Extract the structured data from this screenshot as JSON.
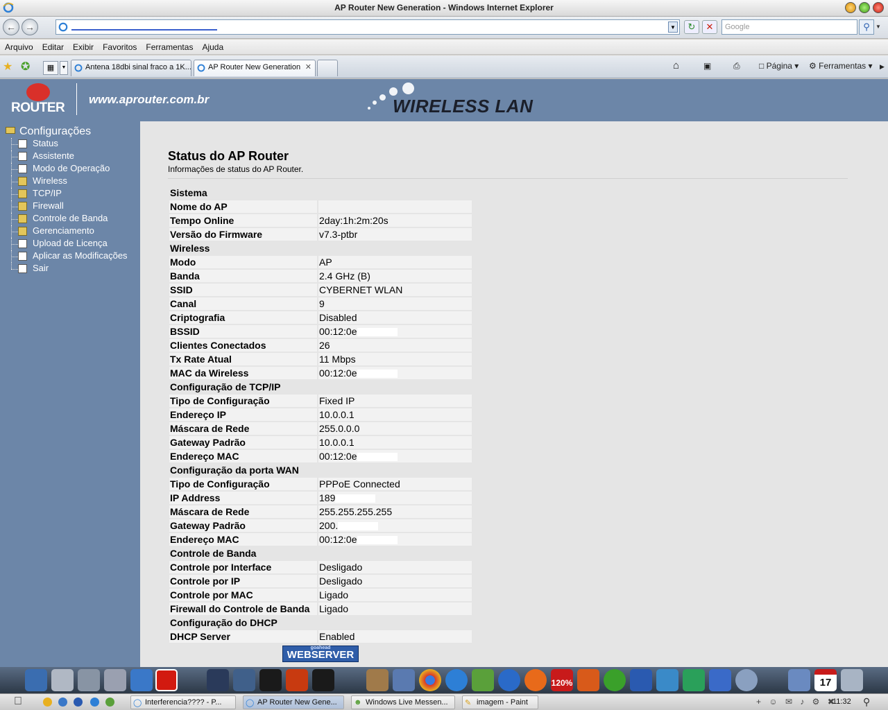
{
  "window": {
    "title": "AP Router New Generation - Windows Internet Explorer"
  },
  "search": {
    "placeholder": "Google"
  },
  "menu": [
    "Arquivo",
    "Editar",
    "Exibir",
    "Favoritos",
    "Ferramentas",
    "Ajuda"
  ],
  "tabs": [
    {
      "label": "Antena 18dbi sinal fraco a 1K..."
    },
    {
      "label": "AP Router New Generation"
    }
  ],
  "toolbar": {
    "page_label": "Página",
    "tools_label": "Ferramentas"
  },
  "banner": {
    "logo": "ROUTER",
    "site": "www.aprouter.com.br",
    "wireless": "WIRELESS LAN"
  },
  "sidebar": {
    "root": "Configurações",
    "items": [
      {
        "label": "Status",
        "icon": "doc"
      },
      {
        "label": "Assistente",
        "icon": "doc"
      },
      {
        "label": "Modo de Operação",
        "icon": "doc"
      },
      {
        "label": "Wireless",
        "icon": "folder"
      },
      {
        "label": "TCP/IP",
        "icon": "folder"
      },
      {
        "label": "Firewall",
        "icon": "folder"
      },
      {
        "label": "Controle de Banda",
        "icon": "folder"
      },
      {
        "label": "Gerenciamento",
        "icon": "folder"
      },
      {
        "label": "Upload de Licença",
        "icon": "doc"
      },
      {
        "label": "Aplicar as Modificações",
        "icon": "doc"
      },
      {
        "label": "Sair",
        "icon": "doc"
      }
    ]
  },
  "content": {
    "title": "Status do AP Router",
    "subtitle": "Informações de status do AP Router.",
    "sections": [
      {
        "name": "Sistema",
        "rows": [
          {
            "label": "Nome do AP",
            "value": ""
          },
          {
            "label": "Tempo Online",
            "value": "2day:1h:2m:20s"
          },
          {
            "label": "Versão do Firmware",
            "value": "v7.3-ptbr"
          }
        ]
      },
      {
        "name": "Wireless",
        "rows": [
          {
            "label": "Modo",
            "value": "AP"
          },
          {
            "label": "Banda",
            "value": "2.4 GHz (B)"
          },
          {
            "label": "SSID",
            "value": "CYBERNET WLAN"
          },
          {
            "label": "Canal",
            "value": "9"
          },
          {
            "label": "Criptografia",
            "value": "Disabled"
          },
          {
            "label": "BSSID",
            "value": "00:12:0e",
            "masked": true
          },
          {
            "label": "Clientes Conectados",
            "value": "26"
          },
          {
            "label": "Tx Rate Atual",
            "value": "11 Mbps"
          },
          {
            "label": "MAC da Wireless",
            "value": "00:12:0e",
            "masked": true
          }
        ]
      },
      {
        "name": "Configuração de TCP/IP",
        "rows": [
          {
            "label": "Tipo de Configuração",
            "value": "Fixed IP"
          },
          {
            "label": "Endereço IP",
            "value": "10.0.0.1"
          },
          {
            "label": "Máscara de Rede",
            "value": "255.0.0.0"
          },
          {
            "label": "Gateway Padrão",
            "value": "10.0.0.1"
          },
          {
            "label": "Endereço MAC",
            "value": "00:12:0e",
            "masked": true
          }
        ]
      },
      {
        "name": "Configuração da porta WAN",
        "rows": [
          {
            "label": "Tipo de Configuração",
            "value": "PPPoE Connected"
          },
          {
            "label": "IP Address",
            "value": "189",
            "masked": true
          },
          {
            "label": "Máscara de Rede",
            "value": "255.255.255.255"
          },
          {
            "label": "Gateway Padrão",
            "value": "200.",
            "masked": true
          },
          {
            "label": "Endereço MAC",
            "value": "00:12:0e",
            "masked": true
          }
        ]
      },
      {
        "name": "Controle de Banda",
        "rows": [
          {
            "label": "Controle por Interface",
            "value": "Desligado"
          },
          {
            "label": "Controle por IP",
            "value": "Desligado"
          },
          {
            "label": "Controle por MAC",
            "value": "Ligado"
          },
          {
            "label": "Firewall do Controle de Banda",
            "value": "Ligado"
          }
        ]
      },
      {
        "name": "Configuração do DHCP",
        "rows": [
          {
            "label": "DHCP Server",
            "value": "Enabled"
          }
        ]
      }
    ],
    "badge": {
      "top": "goahead",
      "main": "WEBSERVER"
    }
  },
  "taskbar": {
    "items": [
      {
        "label": "Interferencia???? - P..."
      },
      {
        "label": "AP Router New Gene..."
      },
      {
        "label": "Windows Live Messen..."
      },
      {
        "label": "imagem - Paint"
      }
    ],
    "clock": "11:32"
  },
  "dock": {
    "calendar_day": "17",
    "zoom_badge": "120%"
  },
  "colors": {
    "banner": "#6c86a8",
    "content_bg": "#e5e5e5",
    "row_bg": "#f2f2f2"
  }
}
